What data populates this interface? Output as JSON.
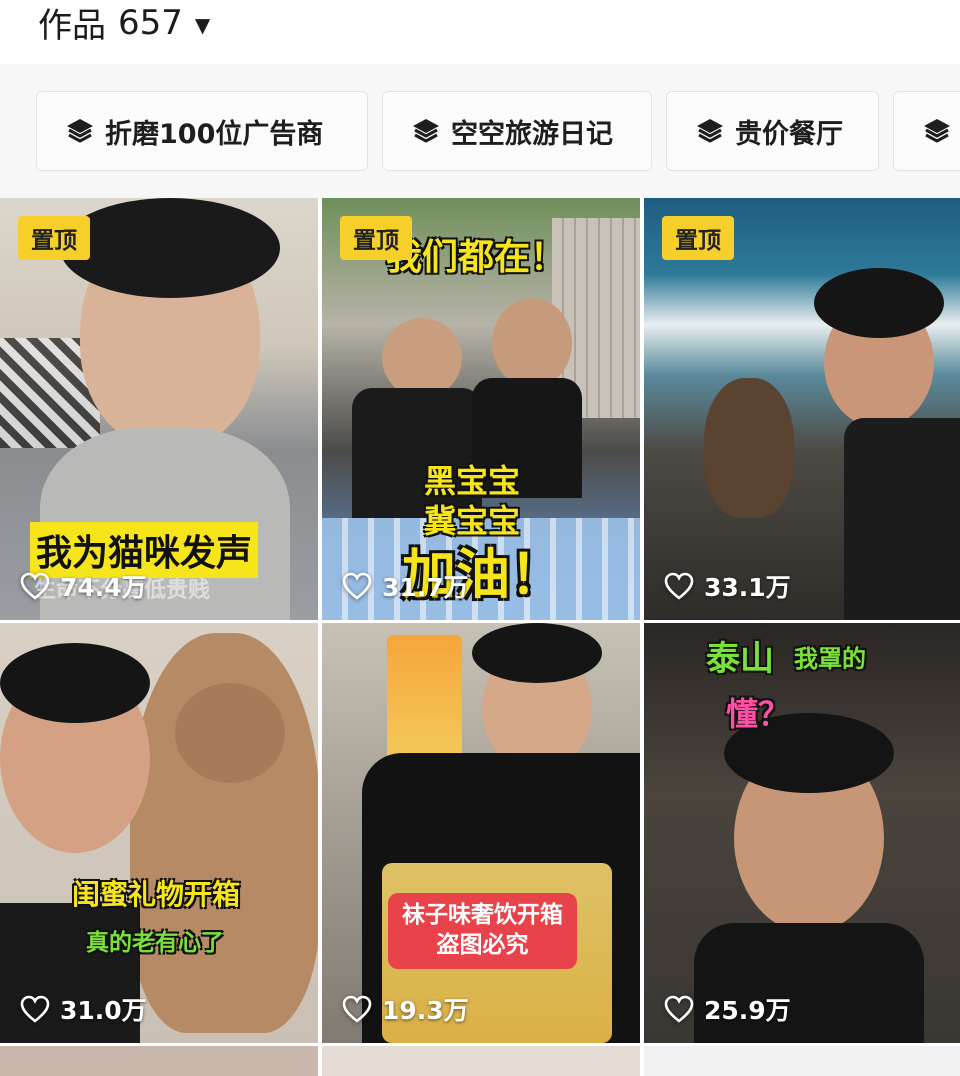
{
  "header": {
    "works_label": "作品",
    "works_count": "657"
  },
  "collections": [
    {
      "label": "折磨100位广告商"
    },
    {
      "label": "空空旅游日记"
    },
    {
      "label": "贵价餐厅"
    }
  ],
  "pinned_label": "置顶",
  "videos": [
    {
      "likes": "74.4万",
      "caption": "我为猫咪发声",
      "subcaption": "生命不分高低贵贱"
    },
    {
      "likes": "31.7万",
      "caption": "我们都在！",
      "caption2": "黑宝宝",
      "caption3": "冀宝宝",
      "caption4": "加油！"
    },
    {
      "likes": "33.1万"
    },
    {
      "likes": "31.0万",
      "caption": "闺蜜礼物开箱",
      "subcaption": "真的老有心了"
    },
    {
      "likes": "19.3万",
      "caption": "袜子味奢饮开箱",
      "subcaption": "盗图必究"
    },
    {
      "likes": "25.9万",
      "caption": "泰山",
      "caption2": "我罩的",
      "caption3": "懂？"
    }
  ],
  "colors": {
    "pin_badge": "#f7cf2a",
    "caption_yellow": "#f6e51a",
    "caption_green": "#7be13a",
    "caption_red": "#e8424a"
  }
}
